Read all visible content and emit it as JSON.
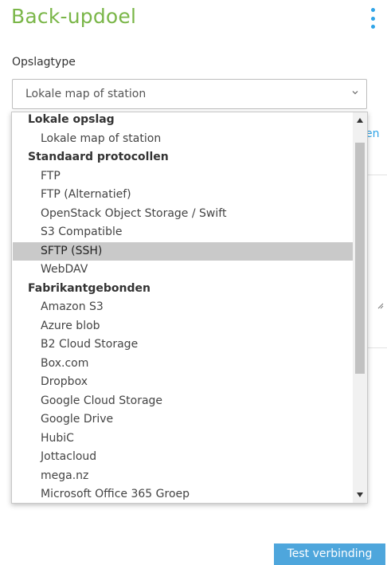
{
  "page": {
    "title": "Back-updoel"
  },
  "storage": {
    "label": "Opslagtype",
    "selected_value": "Lokale map of station"
  },
  "background": {
    "link_fragment": "en"
  },
  "dropdown": {
    "options": [
      {
        "label": "Lokale opslag",
        "type": "group"
      },
      {
        "label": "Lokale map of station",
        "type": "item"
      },
      {
        "label": "Standaard protocollen",
        "type": "group"
      },
      {
        "label": "FTP",
        "type": "item"
      },
      {
        "label": "FTP (Alternatief)",
        "type": "item"
      },
      {
        "label": "OpenStack Object Storage / Swift",
        "type": "item"
      },
      {
        "label": "S3 Compatible",
        "type": "item"
      },
      {
        "label": "SFTP (SSH)",
        "type": "item",
        "highlighted": true
      },
      {
        "label": "WebDAV",
        "type": "item"
      },
      {
        "label": "Fabrikantgebonden",
        "type": "group"
      },
      {
        "label": "Amazon S3",
        "type": "item"
      },
      {
        "label": "Azure blob",
        "type": "item"
      },
      {
        "label": "B2 Cloud Storage",
        "type": "item"
      },
      {
        "label": "Box.com",
        "type": "item"
      },
      {
        "label": "Dropbox",
        "type": "item"
      },
      {
        "label": "Google Cloud Storage",
        "type": "item"
      },
      {
        "label": "Google Drive",
        "type": "item"
      },
      {
        "label": "HubiC",
        "type": "item"
      },
      {
        "label": "Jottacloud",
        "type": "item"
      },
      {
        "label": "mega.nz",
        "type": "item"
      },
      {
        "label": "Microsoft Office 365 Groep",
        "type": "item"
      }
    ]
  },
  "actions": {
    "test_label": "Test verbinding"
  },
  "colors": {
    "title": "#7ab648",
    "accent": "#2fa4e7",
    "button": "#4ea6dc",
    "highlight": "#c9c9c9"
  },
  "icons": {
    "menu": "kebab-vertical-icon",
    "select": "chevron-down-icon"
  }
}
